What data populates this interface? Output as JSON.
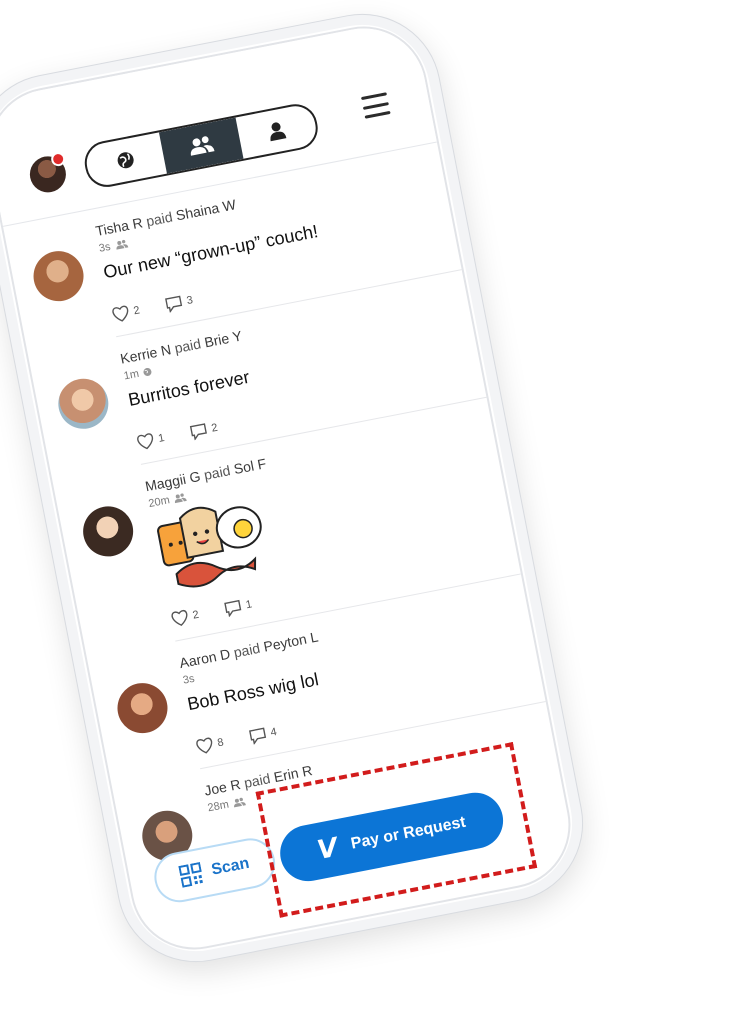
{
  "header": {
    "tabs": [
      "globe-icon",
      "friends-icon",
      "person-icon"
    ],
    "active_tab": "friends"
  },
  "stories": [
    {
      "payer": "Tisha R",
      "verb": "paid",
      "payee": "Shaina W",
      "time": "3s",
      "audience": "friends-icon",
      "note": "Our new “grown-up” couch!",
      "likes": "2",
      "comments": "3",
      "avatar_color": "#a6653f"
    },
    {
      "payer": "Kerrie N",
      "verb": "paid",
      "payee": "Brie Y",
      "time": "1m",
      "audience": "globe-icon",
      "note": "Burritos forever",
      "likes": "1",
      "comments": "2",
      "avatar_color": "#c79071"
    },
    {
      "payer": "Maggii G",
      "verb": "paid",
      "payee": "Sol F",
      "time": "20m",
      "audience": "friends-icon",
      "note": "",
      "likes": "2",
      "comments": "1",
      "avatar_color": "#3b2a22"
    },
    {
      "payer": "Aaron D",
      "verb": "paid",
      "payee": "Peyton L",
      "time": "3s",
      "audience": "",
      "note": "Bob Ross wig lol",
      "likes": "8",
      "comments": "4",
      "avatar_color": "#8a4a32"
    },
    {
      "payer": "Joe R",
      "verb": "paid",
      "payee": "Erin R",
      "time": "28m",
      "audience": "friends-icon",
      "note": "",
      "likes": "",
      "comments": "",
      "avatar_color": "#6a5246"
    }
  ],
  "bottom": {
    "scan_label": "Scan",
    "pay_label": "Pay or Request"
  },
  "colors": {
    "accent": "#0c75d6",
    "highlight": "#d21c1c"
  }
}
